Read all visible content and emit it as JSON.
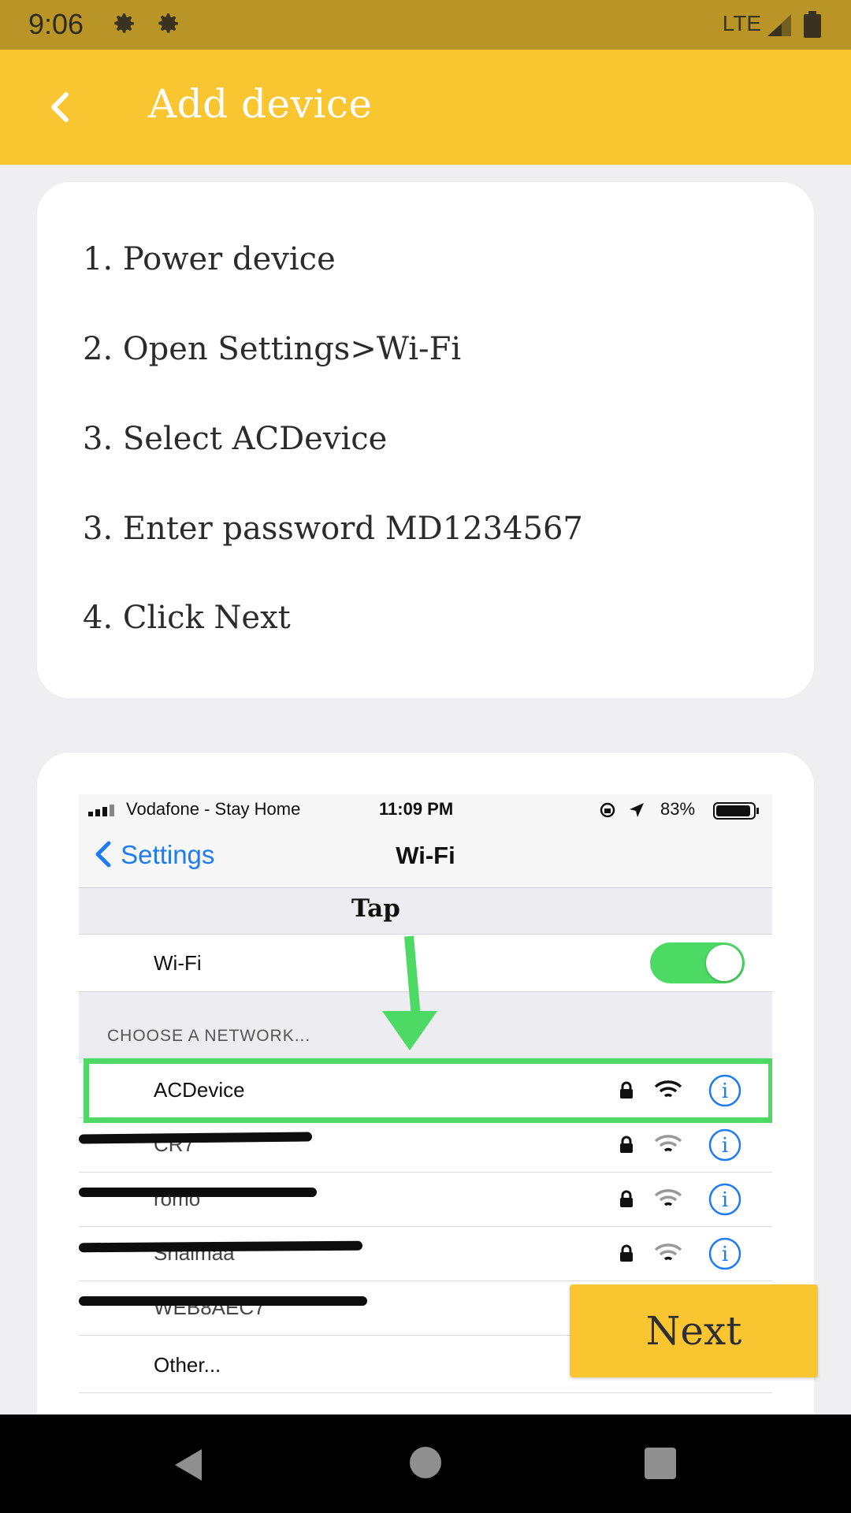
{
  "status_bar": {
    "time": "9:06",
    "network": "LTE"
  },
  "app_bar": {
    "title": "Add device"
  },
  "steps": [
    "1. Power device",
    "2. Open Settings>Wi-Fi",
    "3. Select ACDevice",
    "3. Enter password MD1234567",
    "4. Click Next"
  ],
  "illustration": {
    "carrier": "Vodafone - Stay Home",
    "time": "11:09 PM",
    "battery": "83%",
    "back_label": "Settings",
    "title": "Wi-Fi",
    "annotation": "Tap",
    "wifi_label": "Wi-Fi",
    "section_header": "CHOOSE A NETWORK...",
    "networks": [
      "ACDevice",
      "CR7",
      "romo",
      "Shaimaa",
      "WEB8AEC7"
    ],
    "other_label": "Other...",
    "accent_color": "#1E7CF2",
    "highlight_color": "#4CD964"
  },
  "next_button": {
    "label": "Next"
  },
  "theme": {
    "primary": "#F9C531",
    "status_bar": "#B99528",
    "background": "#EFEFF1"
  }
}
